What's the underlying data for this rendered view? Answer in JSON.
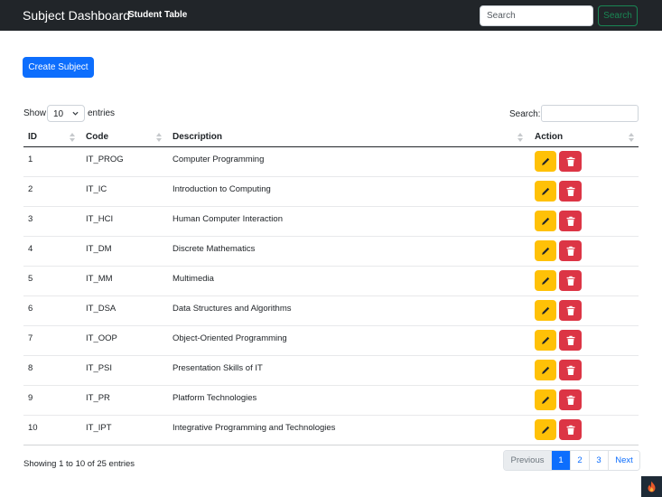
{
  "navbar": {
    "brand": "Subject Dashboard",
    "link": "Student Table",
    "search_placeholder": "Search",
    "search_button": "Search"
  },
  "create_button": "Create Subject",
  "length": {
    "show_label": "Show",
    "value": "10",
    "entries_label": "entries"
  },
  "filter": {
    "label": "Search:"
  },
  "table": {
    "columns": [
      "ID",
      "Code",
      "Description",
      "Action"
    ],
    "rows": [
      {
        "id": "1",
        "code": "IT_PROG",
        "desc": "Computer Programming"
      },
      {
        "id": "2",
        "code": "IT_IC",
        "desc": "Introduction to Computing"
      },
      {
        "id": "3",
        "code": "IT_HCI",
        "desc": "Human Computer Interaction"
      },
      {
        "id": "4",
        "code": "IT_DM",
        "desc": "Discrete Mathematics"
      },
      {
        "id": "5",
        "code": "IT_MM",
        "desc": "Multimedia"
      },
      {
        "id": "6",
        "code": "IT_DSA",
        "desc": "Data Structures and Algorithms"
      },
      {
        "id": "7",
        "code": "IT_OOP",
        "desc": "Object-Oriented Programming"
      },
      {
        "id": "8",
        "code": "IT_PSI",
        "desc": "Presentation Skills of IT"
      },
      {
        "id": "9",
        "code": "IT_PR",
        "desc": "Platform Technologies"
      },
      {
        "id": "10",
        "code": "IT_IPT",
        "desc": "Integrative Programming and Technologies"
      }
    ],
    "row_actions": {
      "edit_icon": "pencil-icon",
      "delete_icon": "trash-icon"
    }
  },
  "footer": {
    "info": "Showing 1 to 10 of 25 entries",
    "pagination": {
      "previous": "Previous",
      "pages": [
        "1",
        "2",
        "3"
      ],
      "active_page": "1",
      "next": "Next"
    }
  },
  "colors": {
    "navbar": "#212529",
    "primary": "#0d6efd",
    "success": "#198754",
    "warning": "#ffc107",
    "danger": "#dc3545"
  },
  "corner_widget_icon": "flame-icon"
}
